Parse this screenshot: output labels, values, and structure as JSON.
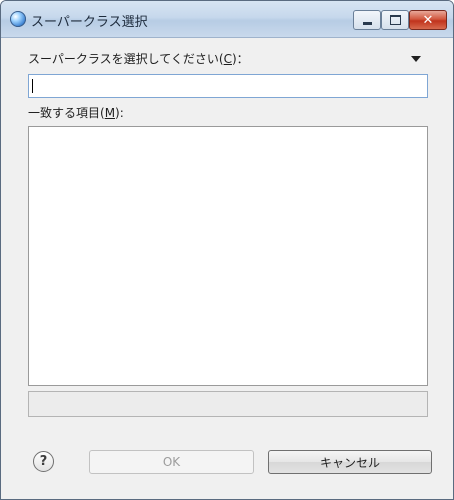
{
  "window": {
    "title": "スーパークラス選択",
    "min_icon": "minimize-icon",
    "max_icon": "maximize-icon",
    "close_icon": "close-icon",
    "close_glyph": "✕"
  },
  "prompt": {
    "label": "スーパークラスを選択してください(",
    "mnemonic": "C",
    "suffix": ")："
  },
  "search": {
    "value": "",
    "placeholder": ""
  },
  "matches": {
    "label": "一致する項目(",
    "mnemonic": "M",
    "suffix": "):",
    "items": []
  },
  "status": {
    "text": ""
  },
  "buttons": {
    "help_glyph": "?",
    "ok": "OK",
    "cancel": "キャンセル"
  },
  "colors": {
    "titlebar": "#c6d8ec",
    "close_button": "#c0331c",
    "input_border": "#7fa6d4",
    "dialog_bg": "#f0f0f0"
  }
}
